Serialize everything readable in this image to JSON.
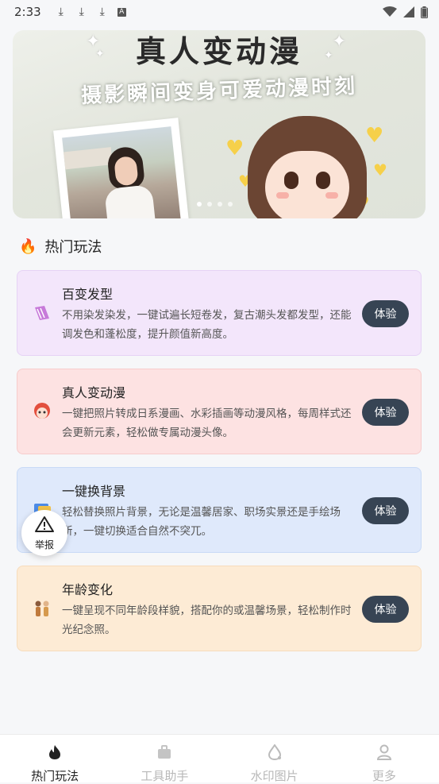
{
  "status_bar": {
    "time": "2:33",
    "icons_left": [
      "download-icon",
      "download-icon",
      "download-icon",
      "a-icon"
    ],
    "icons_right": [
      "wifi-icon",
      "signal-icon",
      "battery-icon"
    ]
  },
  "banner": {
    "title": "真人变动漫",
    "subtitle": "摄影瞬间变身可爱动漫时刻",
    "slide_count": 4,
    "active_slide": 1
  },
  "section": {
    "icon": "fire-icon",
    "title": "热门玩法"
  },
  "features": [
    {
      "title": "百变发型",
      "desc": "不用染发染发，一键试遍长短卷发，复古潮头发都发型，还能调发色和蓬松度，提升颜值新高度。",
      "button": "体验",
      "icon": "comb-icon",
      "bg": "#f3e6fb",
      "border": "#e6d3f5"
    },
    {
      "title": "真人变动漫",
      "desc": "一键把照片转成日系漫画、水彩插画等动漫风格，每周样式还会更新元素，轻松做专属动漫头像。",
      "button": "体验",
      "icon": "anime-face-icon",
      "bg": "#fde2e2",
      "border": "#f6cccc"
    },
    {
      "title": "一键换背景",
      "desc": "轻松替换照片背景，无论是温馨居家、职场实景还是手绘场所，一键切换适合自然不突兀。",
      "button": "体验",
      "icon": "picture-icon",
      "bg": "#dfe9fb",
      "border": "#c9daf6"
    },
    {
      "title": "年龄变化",
      "desc": "一键呈现不同年龄段样貌，搭配你的或温馨场景，轻松制作时光纪念照。",
      "button": "体验",
      "icon": "people-icon",
      "bg": "#fdebd5",
      "border": "#f6dcbc"
    }
  ],
  "report_button": {
    "icon": "warning-icon",
    "label": "举报"
  },
  "tab_bar": [
    {
      "label": "热门玩法",
      "icon": "flame-icon",
      "active": true
    },
    {
      "label": "工具助手",
      "icon": "toolbox-icon",
      "active": false
    },
    {
      "label": "水印图片",
      "icon": "drop-icon",
      "active": false
    },
    {
      "label": "更多",
      "icon": "user-icon",
      "active": false
    }
  ]
}
